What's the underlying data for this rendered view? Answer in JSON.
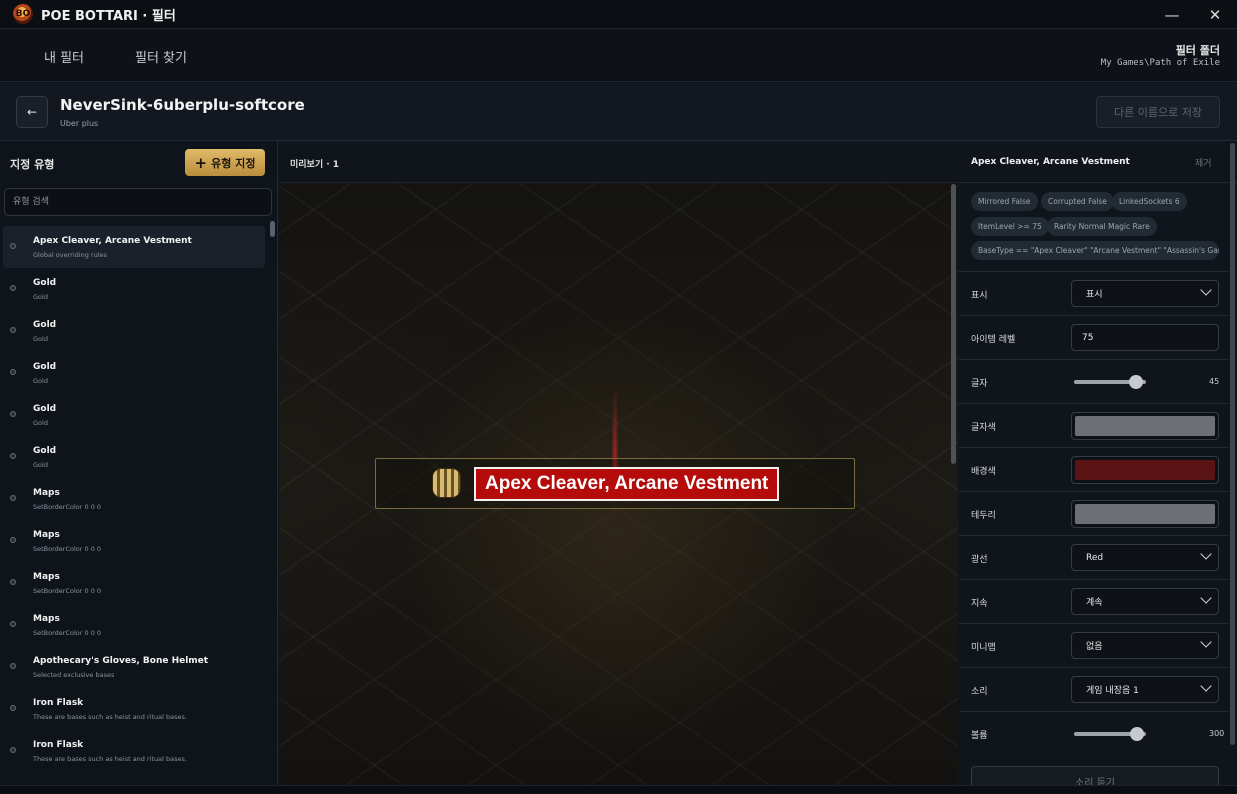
{
  "window": {
    "title": "POE BOTTARI · 필터",
    "logo_text": "BO",
    "minimize_glyph": "—",
    "close_glyph": "✕"
  },
  "nav": {
    "tabs": [
      {
        "label": "내 필터"
      },
      {
        "label": "필터 찾기"
      }
    ],
    "folder_label": "필터 폴더",
    "folder_path": "My Games\\Path of Exile"
  },
  "header": {
    "back_glyph": "←",
    "filter_name": "NeverSink-6uberplu-softcore",
    "filter_subtitle": "Uber plus",
    "save_as_label": "다른 이름으로 저장"
  },
  "left_panel": {
    "title": "지정 유형",
    "add_button_label": "유형 지정",
    "add_button_icon": "+",
    "search_placeholder": "유형 검색",
    "rules": [
      {
        "name": "Apex Cleaver, Arcane Vestment",
        "desc": "Global overriding rules",
        "active": true
      },
      {
        "name": "Gold",
        "desc": "Gold"
      },
      {
        "name": "Gold",
        "desc": "Gold"
      },
      {
        "name": "Gold",
        "desc": "Gold"
      },
      {
        "name": "Gold",
        "desc": "Gold"
      },
      {
        "name": "Gold",
        "desc": "Gold"
      },
      {
        "name": "Maps",
        "desc": "SetBorderColor 0 0 0"
      },
      {
        "name": "Maps",
        "desc": "SetBorderColor 0 0 0"
      },
      {
        "name": "Maps",
        "desc": "SetBorderColor 0 0 0"
      },
      {
        "name": "Maps",
        "desc": "SetBorderColor 0 0 0"
      },
      {
        "name": "Apothecary's Gloves, Bone Helmet",
        "desc": "Selected exclusive bases"
      },
      {
        "name": "Iron Flask",
        "desc": "These are bases such as heist and ritual bases."
      },
      {
        "name": "Iron Flask",
        "desc": "These are bases such as heist and ritual bases."
      }
    ]
  },
  "preview": {
    "title": "미리보기 · 1",
    "item_label": "Apex Cleaver, Arcane Vestment",
    "item_icon": "armour-icon",
    "colors": {
      "label_bg": "#b50b0b",
      "label_text": "#ffffff",
      "label_border": "#f0f0f0",
      "beam": "#d22828"
    }
  },
  "right_panel": {
    "title": "Apex Cleaver, Arcane Vestment",
    "remove_label": "제거",
    "conditions": [
      "Mirrored False",
      "Corrupted False",
      "LinkedSockets 6",
      "ItemLevel >= 75",
      "Rarity Normal Magic Rare",
      "BaseType == \"Apex Cleaver\" \"Arcane Vestment\" \"Assassin's Garb\" ..."
    ],
    "props": {
      "show": {
        "label": "표시",
        "value": "표시"
      },
      "item_level": {
        "label": "아이템 레벨",
        "value": "75"
      },
      "font_size": {
        "label": "글자",
        "value": "45",
        "level": 0.86
      },
      "text_color": {
        "label": "글자색",
        "color": "#6d6f74"
      },
      "bg_color": {
        "label": "배경색",
        "color": "#5a1414"
      },
      "border": {
        "label": "테두리",
        "color": "#6d6f74"
      },
      "beam": {
        "label": "광선",
        "value": "Red"
      },
      "duration": {
        "label": "지속",
        "value": "계속"
      },
      "minimap": {
        "label": "미니맵",
        "value": "없음"
      },
      "sound": {
        "label": "소리",
        "value": "게임 내장음 1"
      },
      "volume": {
        "label": "볼륨",
        "value": "300",
        "level": 0.88
      }
    },
    "play_sound_label": "소리 듣기"
  }
}
